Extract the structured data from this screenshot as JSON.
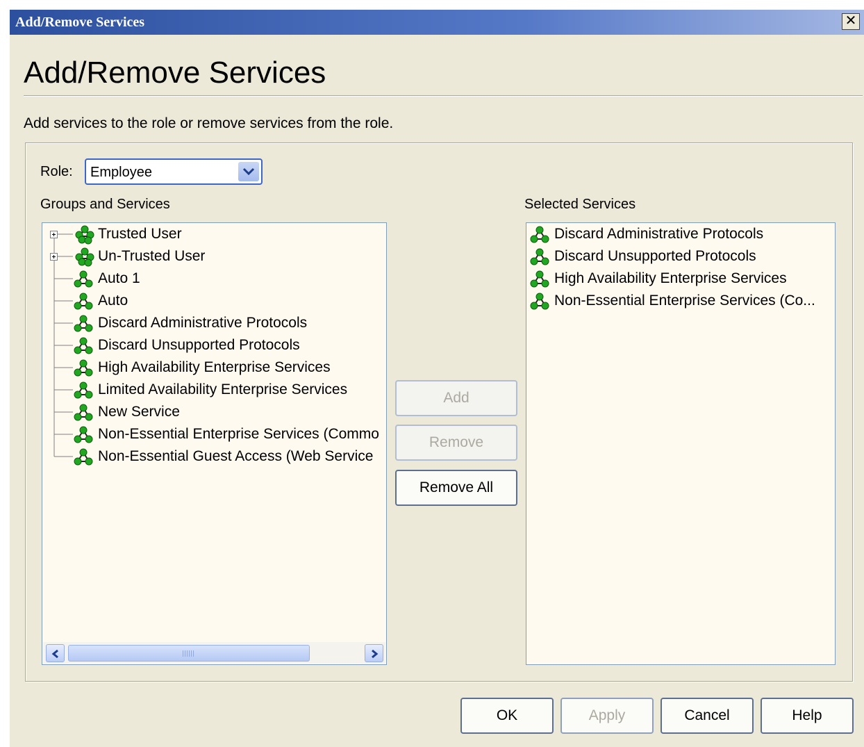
{
  "window": {
    "title": "Add/Remove Services",
    "close_glyph": "✕"
  },
  "page": {
    "heading": "Add/Remove Services",
    "description": "Add services to the role or remove services from the role."
  },
  "role": {
    "label": "Role:",
    "value": "Employee"
  },
  "groups": {
    "label": "Groups and Services",
    "items": [
      {
        "label": "Trusted User",
        "type": "group",
        "expandable": true
      },
      {
        "label": "Un-Trusted User",
        "type": "group",
        "expandable": true
      },
      {
        "label": "Auto 1",
        "type": "service"
      },
      {
        "label": "Auto",
        "type": "service"
      },
      {
        "label": "Discard Administrative Protocols",
        "type": "service"
      },
      {
        "label": "Discard Unsupported Protocols",
        "type": "service"
      },
      {
        "label": "High Availability Enterprise Services",
        "type": "service"
      },
      {
        "label": "Limited Availability Enterprise Services",
        "type": "service"
      },
      {
        "label": "New Service",
        "type": "service"
      },
      {
        "label": "Non-Essential Enterprise Services (Commo",
        "type": "service"
      },
      {
        "label": "Non-Essential Guest Access (Web Service",
        "type": "service"
      }
    ]
  },
  "actions": {
    "add": "Add",
    "remove": "Remove",
    "remove_all": "Remove All"
  },
  "selected": {
    "label": "Selected Services",
    "items": [
      "Discard Administrative Protocols",
      "Discard Unsupported Protocols",
      "High Availability Enterprise Services",
      "Non-Essential Enterprise Services (Co..."
    ]
  },
  "footer": {
    "ok": "OK",
    "apply": "Apply",
    "cancel": "Cancel",
    "help": "Help"
  },
  "colors": {
    "icon_green": "#22a722",
    "title_bar": "#2c4f9e",
    "dialog_bg": "#ece9d8",
    "list_bg": "#fffaf0"
  }
}
